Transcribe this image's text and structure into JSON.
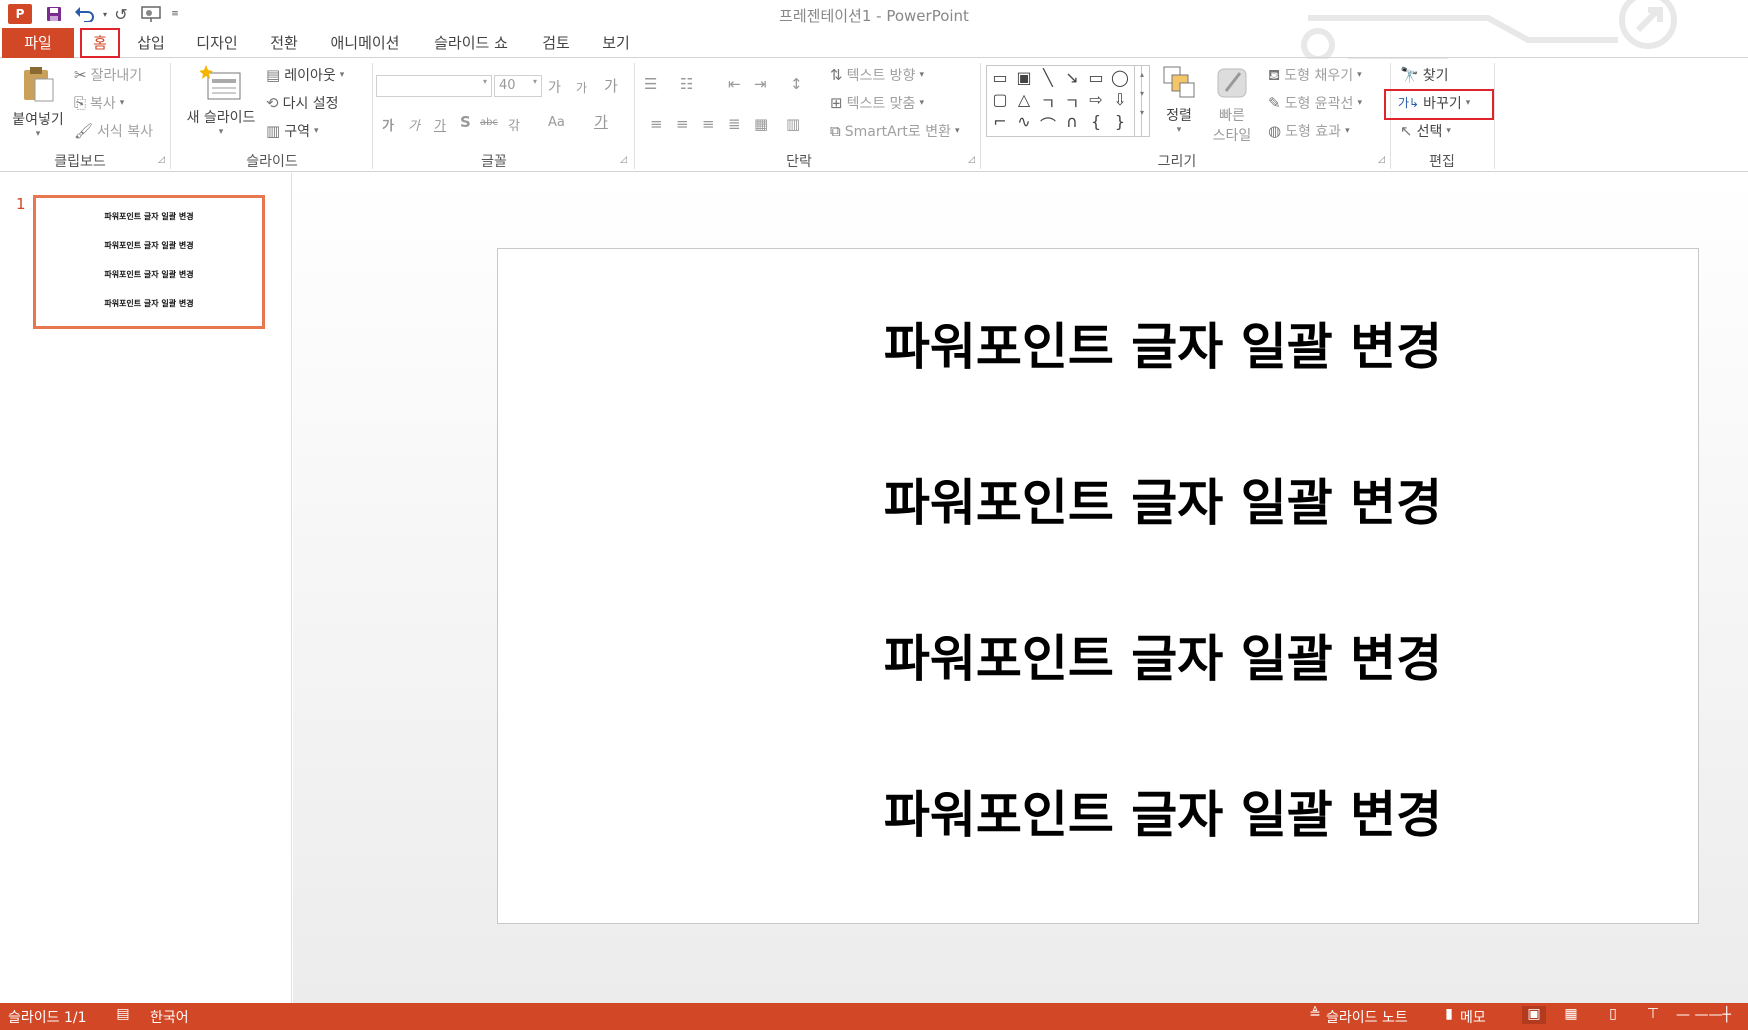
{
  "window": {
    "title": "프레젠테이션1 - PowerPoint"
  },
  "qat": {
    "app_icon": "powerpoint-logo",
    "save": "save-icon",
    "undo": "undo-icon",
    "redo": "redo-icon",
    "present": "present-from-start-icon",
    "customize": "customize-qat-icon"
  },
  "tabs": [
    "파일",
    "홈",
    "삽입",
    "디자인",
    "전환",
    "애니메이션",
    "슬라이드 쇼",
    "검토",
    "보기"
  ],
  "ribbon": {
    "clipboard": {
      "label": "클립보드",
      "paste": "붙여넣기",
      "cut": "잘라내기",
      "copy": "복사",
      "format_painter": "서식 복사"
    },
    "slides": {
      "label": "슬라이드",
      "new_slide": "새 슬라이드",
      "layout": "레이아웃",
      "reset": "다시 설정",
      "section": "구역"
    },
    "font": {
      "label": "글꼴",
      "font_name": "",
      "font_size": "40",
      "grow": "가",
      "shrink": "가",
      "clear": "가",
      "bold": "가",
      "italic": "가",
      "underline": "가",
      "shadow": "S",
      "strike": "abc",
      "spacing": "갂",
      "case": "Aa",
      "color": "가"
    },
    "paragraph": {
      "label": "단락",
      "text_direction": "텍스트 방향",
      "align_text": "텍스트 맞춤",
      "smartart": "SmartArt로 변환"
    },
    "drawing": {
      "label": "그리기",
      "arrange": "정렬",
      "quick_styles_1": "빠른",
      "quick_styles_2": "스타일",
      "shape_fill": "도형 채우기",
      "shape_outline": "도형 윤곽선",
      "shape_effects": "도형 효과"
    },
    "editing": {
      "label": "편집",
      "find": "찾기",
      "replace": "바꾸기",
      "select": "선택"
    }
  },
  "slide_panel": {
    "number": "1",
    "thumbnail_lines": [
      "파워포인트 글자 일괄 변경",
      "파워포인트 글자 일괄 변경",
      "파워포인트 글자 일괄 변경",
      "파워포인트 글자 일괄 변경"
    ]
  },
  "slide": {
    "lines": [
      "파워포인트 글자 일괄 변경",
      "파워포인트 글자 일괄 변경",
      "파워포인트 글자 일괄 변경",
      "파워포인트 글자 일괄 변경"
    ]
  },
  "status": {
    "slide_info": "슬라이드 1/1",
    "language": "한국어",
    "notes": "슬라이드 노트",
    "comments": "메모"
  },
  "colors": {
    "accent": "#d24726",
    "highlight": "#e0242d"
  }
}
